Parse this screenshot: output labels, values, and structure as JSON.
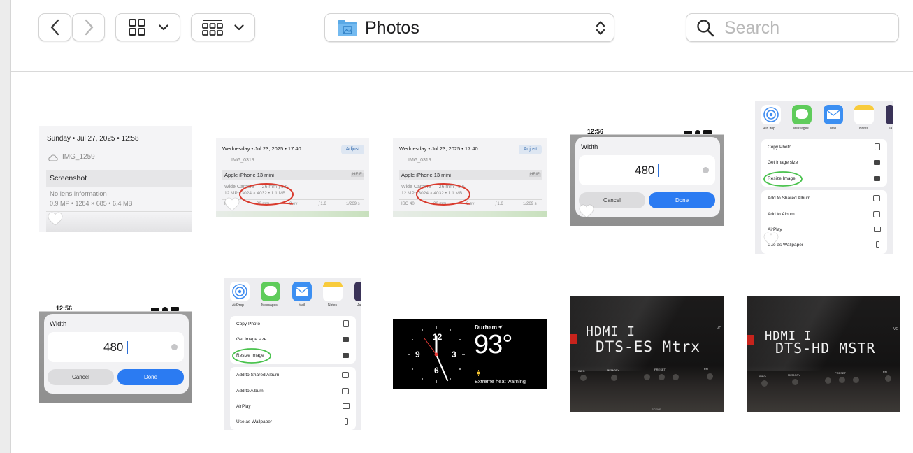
{
  "toolbar": {
    "folder_title": "Photos",
    "search_placeholder": "Search"
  },
  "photos": {
    "p1": {
      "date": "Sunday • Jul 27, 2025 • 12:58",
      "file": "IMG_1259",
      "kind": "Screenshot",
      "lens": "No lens information",
      "specs": "0.9 MP • 1284 × 685 • 6.4 MB"
    },
    "p2": {
      "date": "Wednesday • Jul 23, 2025 • 17:40",
      "adjust": "Adjust",
      "file": "IMG_0319",
      "device": "Apple iPhone 13 mini",
      "format": "HEIF",
      "camera": "Wide Camera — 26 mm ƒ1.6",
      "specs": "12 MP • 3024 × 4032 • 1.1 MB",
      "exif": [
        "ISO 40",
        "26 mm",
        "0 ev",
        "ƒ1.6",
        "1/269 s"
      ]
    },
    "p3": {
      "date": "Wednesday • Jul 23, 2025 • 17:40",
      "adjust": "Adjust",
      "file": "IMG_0319",
      "device": "Apple iPhone 13 mini",
      "format": "HEIF",
      "camera": "Wide Camera — 26 mm ƒ1.6",
      "specs": "12 MP • 3024 × 4032 • 1.1 MB",
      "exif": [
        "ISO 40",
        "26 mm",
        "0 ev",
        "ƒ1.6",
        "1/269 s"
      ]
    },
    "p4": {
      "time": "12:56",
      "label": "Width",
      "value": "480",
      "cancel": "Cancel",
      "done": "Done"
    },
    "p5": {
      "apps": [
        "AirDrop",
        "Messages",
        "Mail",
        "Notes",
        "Ja"
      ],
      "actions": [
        "Copy Photo",
        "Get image size",
        "Resize Image",
        "Add to Shared Album",
        "Add to Album",
        "AirPlay",
        "Use as Wallpaper"
      ]
    },
    "p6": {
      "time": "12:56",
      "label": "Width",
      "value": "480",
      "cancel": "Cancel",
      "done": "Done"
    },
    "p7": {
      "apps": [
        "AirDrop",
        "Messages",
        "Mail",
        "Notes",
        "Ja"
      ],
      "actions": [
        "Copy Photo",
        "Get image size",
        "Resize Image",
        "Add to Shared Album",
        "Add to Album",
        "AirPlay",
        "Use as Wallpaper"
      ]
    },
    "p8": {
      "city": "Durham",
      "temp": "93°",
      "warning": "Extreme heat warning",
      "clock_nums": [
        "12",
        "3",
        "6",
        "9"
      ]
    },
    "p9": {
      "line1": "HDMI I",
      "line2": "DTS-ES Mtrx",
      "brand": "VO",
      "labels": [
        "INFO",
        "MEMORY",
        "PRESET",
        "FM",
        "SCENE"
      ]
    },
    "p10": {
      "line1": "HDMI I",
      "line2": "DTS-HD MSTR",
      "brand": "VO",
      "labels": [
        "INFO",
        "MEMORY",
        "PRESET",
        "FM"
      ]
    }
  }
}
